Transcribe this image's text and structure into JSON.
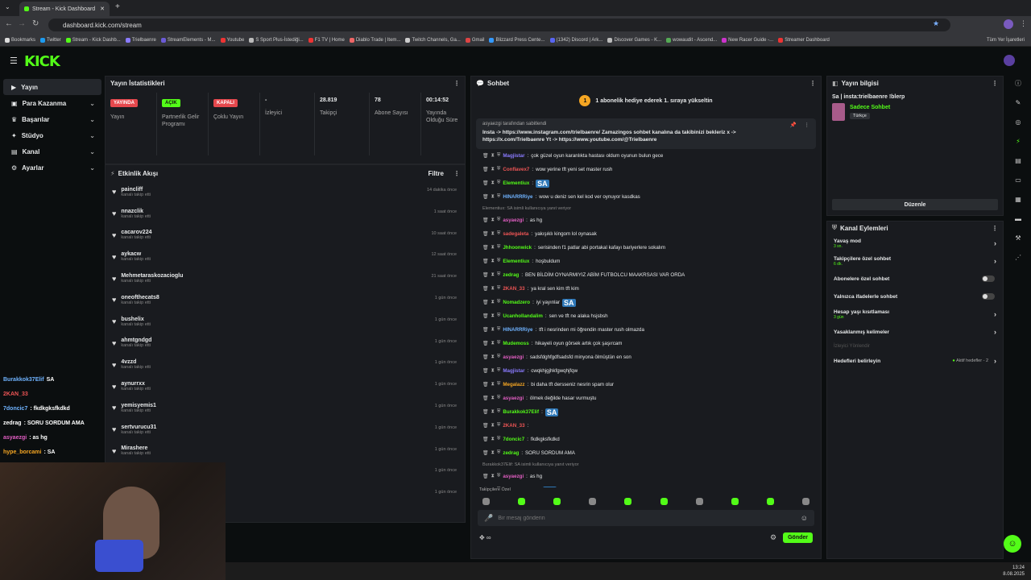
{
  "browser": {
    "tab_title": "Stream - Kick Dashboard",
    "url": "dashboard.kick.com/stream",
    "bookmarks": [
      "Bookmarks",
      "Twitter",
      "Stream - Kick Dashb...",
      "Trielbaenre",
      "StreamElements - M...",
      "Youtube",
      "S Sport Plus-İstediği...",
      "F1 TV | Home",
      "Diablo Trade | Item...",
      "Twitch Channels, Ga...",
      "Gmail",
      "Blizzard Press Cente...",
      "(1342) Discord | Ark...",
      "Discover Games - K...",
      "wowaudit - Ascend...",
      "New Racer Guide -...",
      "Streamer Dashboard"
    ],
    "bookmarks_right": "Tüm Yer İşaretleri"
  },
  "brand": {
    "logo": "KICK",
    "accent": "#53fc18"
  },
  "sidebar": {
    "items": [
      {
        "label": "Yayın",
        "icon": "video-icon",
        "active": true
      },
      {
        "label": "Para Kazanma",
        "icon": "wallet-icon"
      },
      {
        "label": "Başarılar",
        "icon": "trophy-icon"
      },
      {
        "label": "Stüdyo",
        "icon": "studio-icon"
      },
      {
        "label": "Kanal",
        "icon": "channel-icon"
      },
      {
        "label": "Ayarlar",
        "icon": "gear-icon"
      }
    ]
  },
  "stats": {
    "title": "Yayın İstatistikleri",
    "cells": [
      {
        "badge": "YAYINDA",
        "badge_color": "#e5484d",
        "label": "Yayın"
      },
      {
        "badge": "AÇIK",
        "badge_color": "#53fc18",
        "label": "Partnerlik Gelir Programı"
      },
      {
        "badge": "KAPALI",
        "badge_color": "#e5484d",
        "label": "Çoklu Yayın"
      },
      {
        "value": "-",
        "label": "İzleyici"
      },
      {
        "value": "28.819",
        "label": "Takipçi"
      },
      {
        "value": "78",
        "label": "Abone Sayısı"
      },
      {
        "value": "00:14:52",
        "label": "Yayında Olduğu Süre"
      }
    ]
  },
  "events": {
    "title": "Etkinlik Akışı",
    "filter": "Filtre",
    "items": [
      {
        "name": "paincliff",
        "sub": "kanalı takip etti",
        "time": "14 dakika önce"
      },
      {
        "name": "nnazclik",
        "sub": "kanalı takip etti",
        "time": "1 saat önce"
      },
      {
        "name": "cacarov224",
        "sub": "kanalı takip etti",
        "time": "10 saat önce"
      },
      {
        "name": "aykacw",
        "sub": "kanalı takip etti",
        "time": "12 saat önce"
      },
      {
        "name": "Mehmetaraskozacioglu",
        "sub": "kanalı takip etti",
        "time": "21 saat önce"
      },
      {
        "name": "oneofthecats8",
        "sub": "kanalı takip etti",
        "time": "1 gün önce"
      },
      {
        "name": "bushelix",
        "sub": "kanalı takip etti",
        "time": "1 gün önce"
      },
      {
        "name": "ahmtgndgd",
        "sub": "kanalı takip etti",
        "time": "1 gün önce"
      },
      {
        "name": "4vzzd",
        "sub": "kanalı takip etti",
        "time": "1 gün önce"
      },
      {
        "name": "aynurrxx",
        "sub": "kanalı takip etti",
        "time": "1 gün önce"
      },
      {
        "name": "yemisyemis1",
        "sub": "kanalı takip etti",
        "time": "1 gün önce"
      },
      {
        "name": "sertvurucu31",
        "sub": "kanalı takip etti",
        "time": "1 gün önce"
      },
      {
        "name": "Mirashere",
        "sub": "kanalı takip etti",
        "time": "1 gün önce"
      },
      {
        "name": "",
        "sub": "",
        "time": "1 gün önce"
      },
      {
        "name": "",
        "sub": "",
        "time": "1 gün önce"
      }
    ]
  },
  "chat": {
    "title": "Sohbet",
    "goal": "1 abonelik hediye ederek 1. sıraya yükseltin",
    "goal_num": "1",
    "pinned_by": "asyaezgi tarafından sabitlendi",
    "pinned_text": "Insta -> https://www.instagram.com/trielbaenre/ Zamazingos sohbet kanalına da takibinizi bekleriz x -> https://x.com/Trielbaenre Yt -> https://www.youtube.com/@Trielbaenre",
    "messages": [
      {
        "user": "Magjistar",
        "color": "#8a7bff",
        "text": "çok güzel oyun karanlıkta hastası oldum oyunun bulun gece"
      },
      {
        "user": "Conflavex7",
        "color": "#e55",
        "text": "wow yerine tft yeni set master rush"
      },
      {
        "user": "Elementiux",
        "color": "#53fc18",
        "text": "",
        "emote": "SA"
      },
      {
        "user": "HINARRRiye",
        "color": "#6fb3ff",
        "text": "wow u deniz sen kel kod ver oynuyor kasdkas"
      },
      {
        "reply": "Elementiux: SA isimli kullanıcıya yanıt veriyor"
      },
      {
        "user": "asyaezgi",
        "color": "#e25ec3",
        "text": "as hg"
      },
      {
        "user": "sadegaleta",
        "color": "#e55",
        "text": "yakışıklı kingom lol oynasak"
      },
      {
        "user": "Jhhoonwick",
        "color": "#53fc18",
        "text": "serisinden f1 patlar abi portakal kafayı bariyerlere sokalım"
      },
      {
        "user": "Elementiux",
        "color": "#53fc18",
        "text": "hoşbuldum"
      },
      {
        "user": "zedrag",
        "color": "#53fc18",
        "text": "BEN BİLDİM OYNARMIYIZ ABİM FUTBOLCU MAAKRSASI VAR ORDA"
      },
      {
        "user": "2KAN_33",
        "color": "#e55",
        "text": "ya kral sen kim tft kim"
      },
      {
        "user": "Nomadzero",
        "color": "#53fc18",
        "text": "iyi yayınlar",
        "emote": "SA"
      },
      {
        "user": "Ucanhollandalim",
        "color": "#53fc18",
        "text": "sen ve tft ne alaka hsjsbsh"
      },
      {
        "user": "HINARRRiye",
        "color": "#6fb3ff",
        "text": "tft i nesrinden mi öğrendin master rush olmazda"
      },
      {
        "user": "Mudemoss",
        "color": "#53fc18",
        "text": "hikayeli oyun görsek artık çok şaşırcam"
      },
      {
        "user": "asyaezgi",
        "color": "#e25ec3",
        "text": "sadsfdghfgdfsadsfd minyona ölmüştün en son"
      },
      {
        "user": "Magjistar",
        "color": "#8a7bff",
        "text": "cwqkhjgjhkfgwqhjfqw"
      },
      {
        "user": "Megalazz",
        "color": "#f5a623",
        "text": "bi daha tft dersseniz nesrin spam olur"
      },
      {
        "user": "asyaezgi",
        "color": "#e25ec3",
        "text": "ölmek değilde hasar vurmuştu"
      },
      {
        "user": "Burakkok37Elif",
        "color": "#53fc18",
        "text": "",
        "emote": "SA"
      },
      {
        "user": "2KAN_33",
        "color": "#e55",
        "text": ""
      },
      {
        "user": "7doncic7",
        "color": "#53fc18",
        "text": "fkdkgksfkdkd"
      },
      {
        "user": "zedrag",
        "color": "#53fc18",
        "text": "SORU SORDUM AMA"
      },
      {
        "reply": "Burakkok37Elif: SA isimli kullanıcıya yanıt veriyor"
      },
      {
        "user": "asyaezgi",
        "color": "#e25ec3",
        "text": "as hg"
      },
      {
        "user": "hype_borcami",
        "color": "#f5a623",
        "text": "",
        "emote": "SA"
      }
    ],
    "mode": "Takipçilere Özel",
    "placeholder": "Bir mesaj gönderin",
    "send": "Gönder"
  },
  "streaminfo": {
    "title": "Yayın bilgisi",
    "stream_title": "Sa | insta:trielbaenre !blerp",
    "category": "Sadece Sohbet",
    "lang": "Türkçe",
    "edit": "Düzenle"
  },
  "actions": {
    "title": "Kanal Eylemleri",
    "items": [
      {
        "label": "Yavaş mod",
        "sub": "3 sn.",
        "type": "arrow"
      },
      {
        "label": "Takipçilere özel sohbet",
        "sub": "6 dk.",
        "type": "arrow"
      },
      {
        "label": "Abonelere özel sohbet",
        "type": "toggle"
      },
      {
        "label": "Yalnızca ifadelerle sohbet",
        "type": "toggle"
      },
      {
        "label": "Hesap yaşı kısıtlaması",
        "sub": "3 gün",
        "type": "arrow"
      },
      {
        "label": "Yasaklanmış kelimeler",
        "type": "arrow"
      }
    ],
    "viewer_dir": "İzleyici Yönlendir",
    "goals": "Hedefleri belirleyin",
    "goals_status": "Aktif hedefler - 2"
  },
  "overlay": [
    {
      "user": "Burakkok37Elif",
      "color": "#6fb3ff",
      "text": "SA"
    },
    {
      "user": "2KAN_33",
      "color": "#e55",
      "text": ""
    },
    {
      "user": "7doncic7",
      "color": "#6fb3ff",
      "text": ": fkdkgksfkdkd"
    },
    {
      "user": "zedrag",
      "color": "#fff",
      "text": ": SORU SORDUM AMA"
    },
    {
      "user": "asyaezgi",
      "color": "#e25ec3",
      "text": ": as hg"
    },
    {
      "user": "hype_borcami",
      "color": "#f5a623",
      "text": ": SA"
    }
  ],
  "clock": {
    "time": "13:24",
    "date": "8.08.2025"
  }
}
